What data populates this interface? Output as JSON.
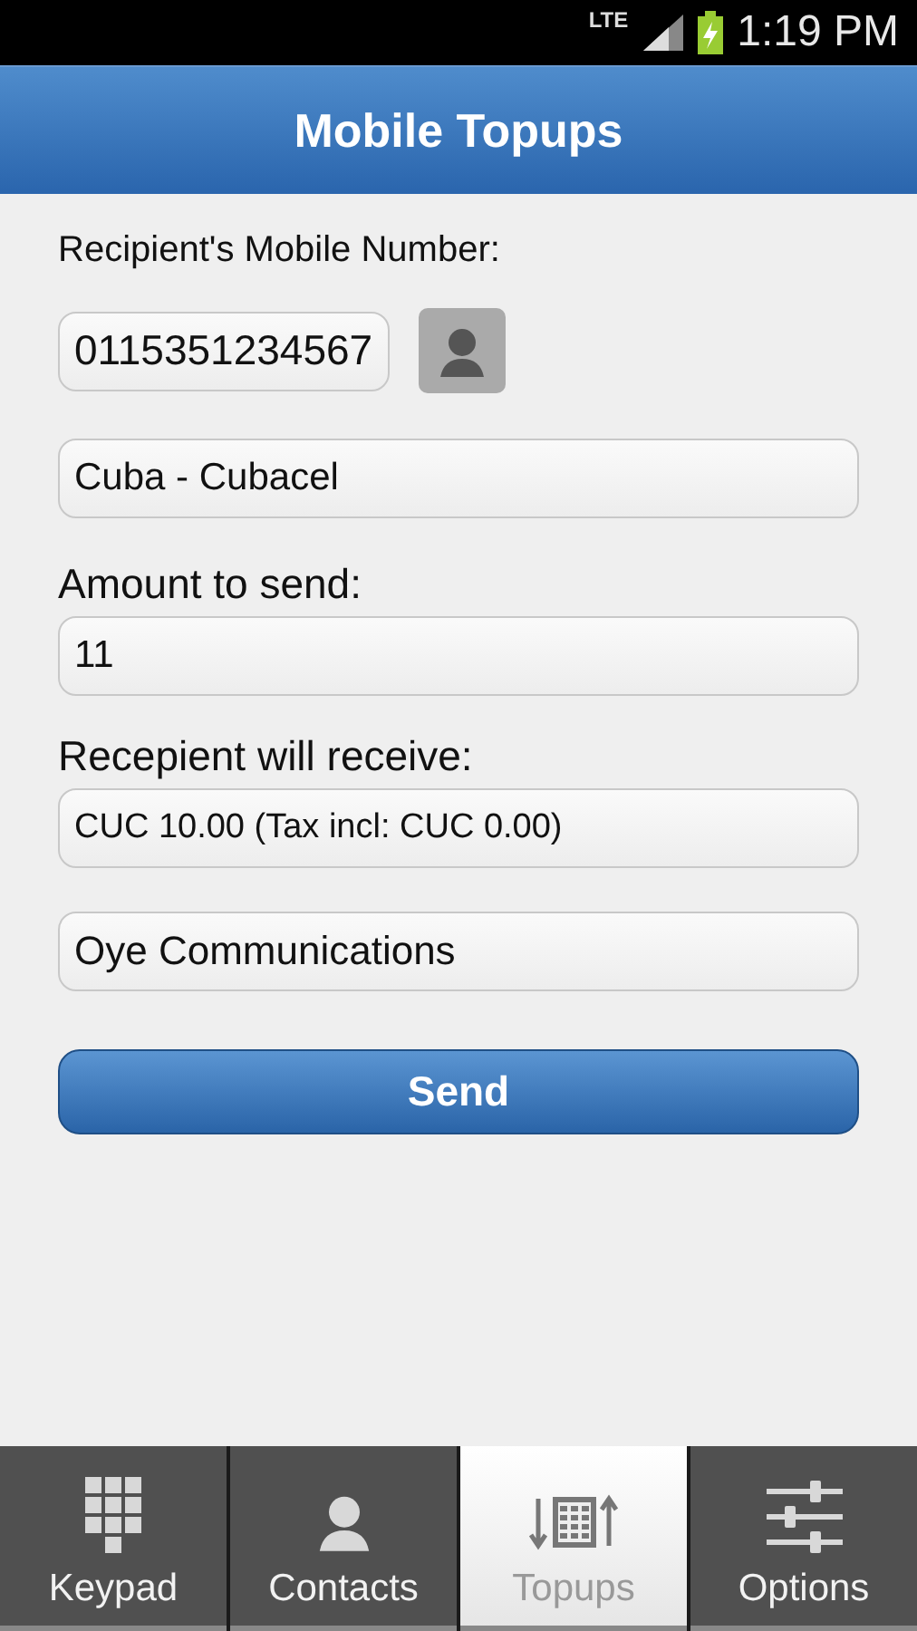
{
  "status_bar": {
    "network": "LTE",
    "time": "1:19 PM"
  },
  "header": {
    "title": "Mobile Topups"
  },
  "form": {
    "recipient_label": "Recipient's Mobile Number:",
    "mobile_number": "0115351234567",
    "country_operator": "Cuba - Cubacel",
    "amount_label": "Amount to send:",
    "amount": "11",
    "receive_label": "Recepient will receive:",
    "receive_value": "CUC 10.00  (Tax incl: CUC 0.00)",
    "provider": "Oye Communications",
    "send_button": "Send"
  },
  "tabs": [
    {
      "label": "Keypad",
      "kind": "keypad",
      "selected": false
    },
    {
      "label": "Contacts",
      "kind": "contacts",
      "selected": false
    },
    {
      "label": "Topups",
      "kind": "topups",
      "selected": true
    },
    {
      "label": "Options",
      "kind": "options",
      "selected": false
    }
  ]
}
